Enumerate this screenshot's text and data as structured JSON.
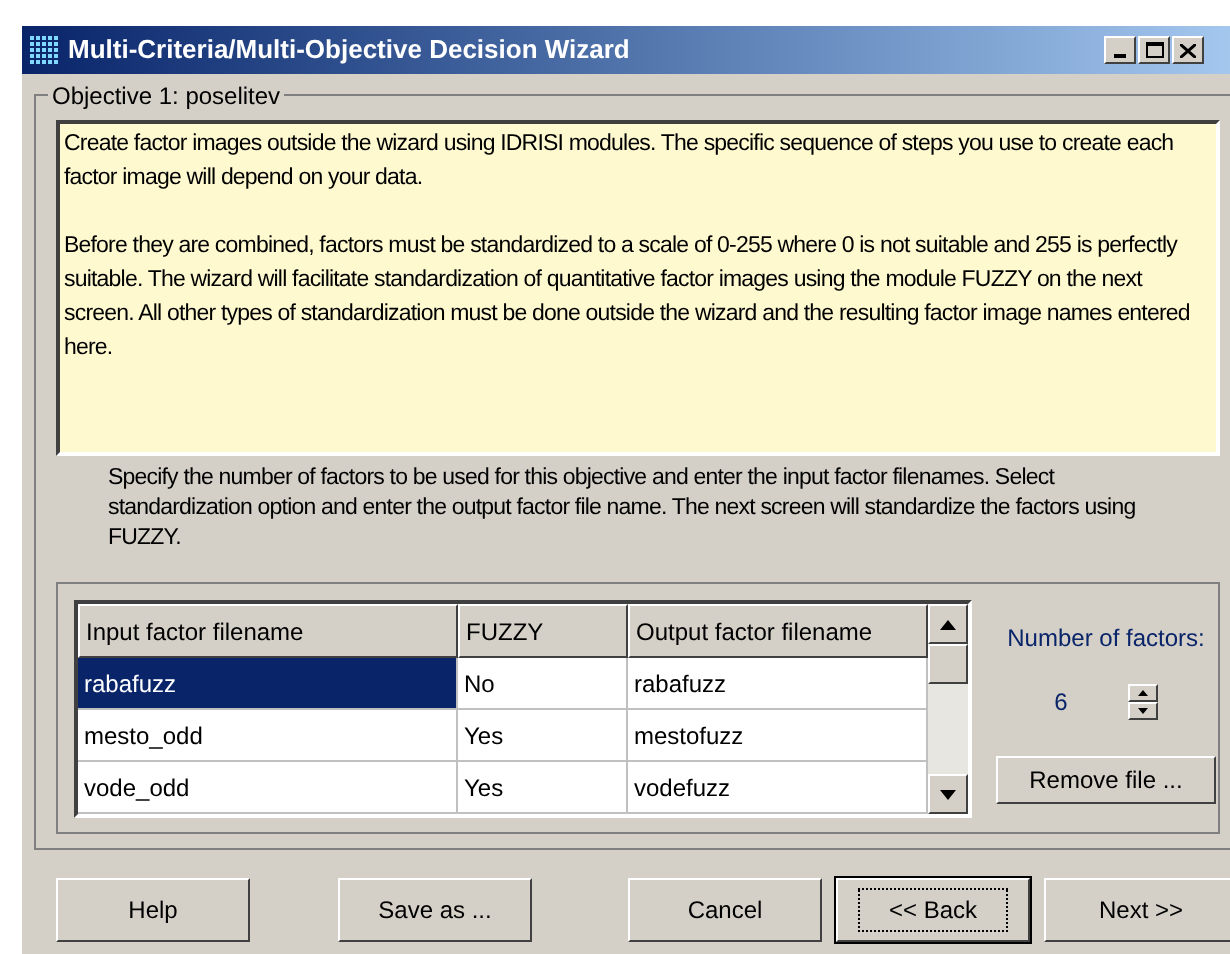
{
  "window": {
    "title": "Multi-Criteria/Multi-Objective Decision Wizard"
  },
  "group": {
    "label": "Objective 1: poselitev"
  },
  "info_paragraphs": [
    "Create factor images outside the wizard using IDRISI modules. The specific sequence of steps you use to create each factor image will depend on your data.",
    "Before they are combined, factors must be standardized to a scale of 0-255 where 0 is not suitable and 255 is perfectly suitable. The wizard will facilitate standardization of quantitative factor images using the module FUZZY on the next screen. All other types of standardization must be done outside the wizard and the resulting factor image names entered here."
  ],
  "instructions": "Specify the number of factors to be used for this objective and enter the input factor filenames. Select standardization option and enter the output factor file name. The next screen will standardize the factors using FUZZY.",
  "table": {
    "columns": [
      "Input factor filename",
      "FUZZY",
      "Output factor filename"
    ],
    "rows": [
      {
        "cells": [
          "rabafuzz",
          "No",
          "rabafuzz"
        ],
        "selected": true
      },
      {
        "cells": [
          "mesto_odd",
          "Yes",
          "mestofuzz"
        ],
        "selected": false
      },
      {
        "cells": [
          "vode_odd",
          "Yes",
          "vodefuzz"
        ],
        "selected": false
      }
    ]
  },
  "factors": {
    "label": "Number of factors:",
    "value": "6"
  },
  "remove_button": "Remove file ...",
  "buttons": [
    {
      "label": "Help",
      "default": false
    },
    {
      "label": "Save as ...",
      "default": false
    },
    {
      "label": "Cancel",
      "default": false
    },
    {
      "label": "<< Back",
      "default": true
    },
    {
      "label": "Next >>",
      "default": false
    }
  ]
}
